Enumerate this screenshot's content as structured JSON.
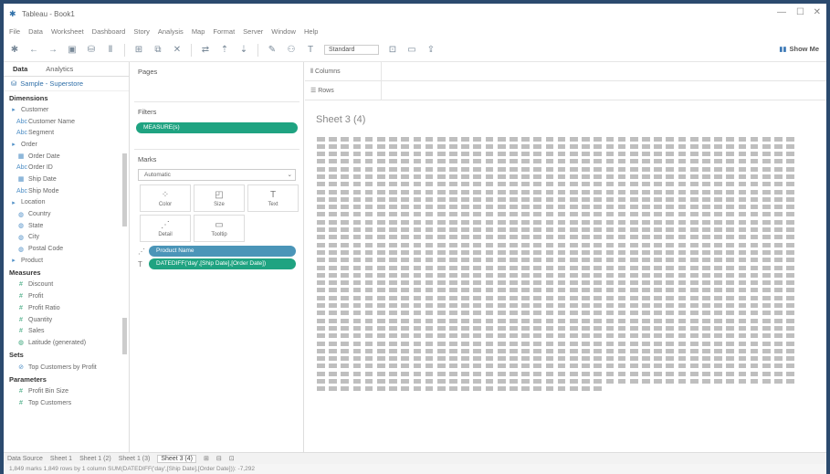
{
  "window": {
    "title": "Tableau - Book1",
    "controls": [
      "—",
      "☐",
      "✕"
    ]
  },
  "menu": [
    "File",
    "Data",
    "Worksheet",
    "Dashboard",
    "Story",
    "Analysis",
    "Map",
    "Format",
    "Server",
    "Window",
    "Help"
  ],
  "toolbar": {
    "standard": "Standard",
    "show_me_label": "Show Me",
    "icons": [
      "tableau-logo-icon",
      "undo-icon",
      "redo-icon",
      "save-icon",
      "new-datasource-icon",
      "pause-icon",
      "new-sheet-icon",
      "duplicate-icon",
      "clear-icon",
      "swap-icon",
      "sort-asc-icon",
      "sort-desc-icon",
      "highlight-icon",
      "group-icon",
      "label-icon",
      "fix-axes-icon",
      "fit-icon",
      "present-icon",
      "share-icon"
    ]
  },
  "datapane": {
    "tabs": [
      "Data",
      "Analytics"
    ],
    "datasource": "Sample - Superstore",
    "dimensions_label": "Dimensions",
    "dimensions": [
      {
        "label": "Customer",
        "icon": "folder-icon"
      },
      {
        "label": "Customer Name",
        "icon": "abc-icon"
      },
      {
        "label": "Segment",
        "icon": "abc-icon"
      },
      {
        "label": "Order",
        "icon": "folder-icon"
      },
      {
        "label": "Order Date",
        "icon": "date-icon"
      },
      {
        "label": "Order ID",
        "icon": "abc-icon"
      },
      {
        "label": "Ship Date",
        "icon": "date-icon"
      },
      {
        "label": "Ship Mode",
        "icon": "abc-icon"
      },
      {
        "label": "Location",
        "icon": "folder-icon"
      },
      {
        "label": "Country",
        "icon": "globe-icon"
      },
      {
        "label": "State",
        "icon": "globe-icon"
      },
      {
        "label": "City",
        "icon": "globe-icon"
      },
      {
        "label": "Postal Code",
        "icon": "globe-icon"
      },
      {
        "label": "Product",
        "icon": "folder-icon"
      }
    ],
    "measures_label": "Measures",
    "measures": [
      {
        "label": "Discount",
        "icon": "hash-icon"
      },
      {
        "label": "Profit",
        "icon": "hash-icon"
      },
      {
        "label": "Profit Ratio",
        "icon": "hash-icon"
      },
      {
        "label": "Quantity",
        "icon": "hash-icon"
      },
      {
        "label": "Sales",
        "icon": "hash-icon"
      },
      {
        "label": "Latitude (generated)",
        "icon": "globe-icon"
      }
    ],
    "sets_label": "Sets",
    "sets": [
      {
        "label": "Top Customers by Profit",
        "icon": "set-icon"
      }
    ],
    "parameters_label": "Parameters",
    "parameters": [
      {
        "label": "Profit Bin Size",
        "icon": "hash-icon"
      },
      {
        "label": "Top Customers",
        "icon": "hash-icon"
      }
    ]
  },
  "shelves": {
    "pages_label": "Pages",
    "filters_label": "Filters",
    "filter_pill": "MEASURE(s)",
    "marks_label": "Marks",
    "mark_type": "Automatic",
    "mark_buttons": [
      {
        "label": "Color",
        "icon": "color-icon"
      },
      {
        "label": "Size",
        "icon": "size-icon"
      },
      {
        "label": "Text",
        "icon": "text-icon"
      },
      {
        "label": "Detail",
        "icon": "detail-icon"
      },
      {
        "label": "Tooltip",
        "icon": "tooltip-icon"
      }
    ],
    "mark_pills": [
      {
        "label": "Product Name",
        "kind": "blue",
        "icon": "detail-icon"
      },
      {
        "label": "DATEDIFF('day',[Ship Date],[Order Date])",
        "kind": "green",
        "icon": "text-icon"
      }
    ],
    "columns_label": "Columns",
    "rows_label": "Rows"
  },
  "view": {
    "sheet_title": "Sheet 3 (4)",
    "text_rows": 34,
    "text_cols": 40,
    "last_row_cols": 24
  },
  "sheet_tabs": {
    "items": [
      "Data Source",
      "Sheet 1",
      "Sheet 1 (2)",
      "Sheet 1 (3)",
      "Sheet 3 (4)"
    ],
    "active_index": 4,
    "icons": [
      "new-worksheet-icon",
      "new-dashboard-icon",
      "new-story-icon"
    ]
  },
  "status": {
    "text": "1,849 marks   1,849 rows by 1 column   SUM(DATEDIFF('day',[Ship Date],[Order Date])): -7,292"
  }
}
